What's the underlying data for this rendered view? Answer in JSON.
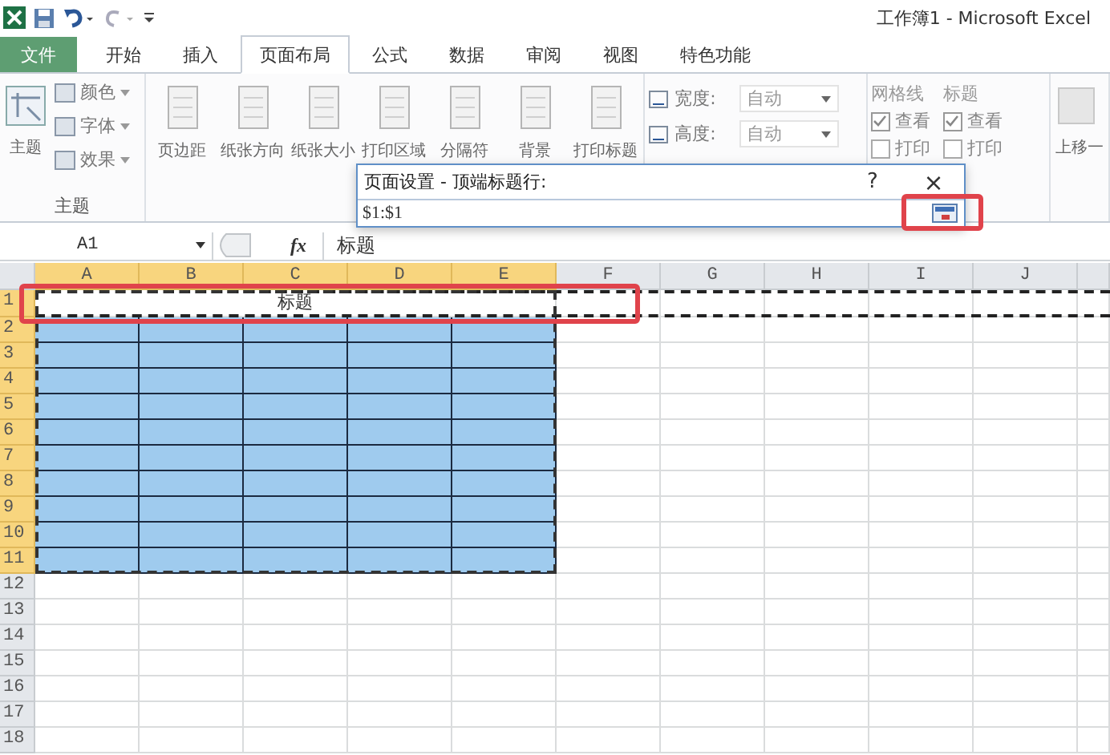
{
  "title_bar": {
    "title": "工作簿1 - Microsoft Excel"
  },
  "tabs": [
    {
      "label": "文件",
      "kind": "file",
      "selected": false
    },
    {
      "label": "开始",
      "kind": "tab",
      "selected": false
    },
    {
      "label": "插入",
      "kind": "tab",
      "selected": false
    },
    {
      "label": "页面布局",
      "kind": "tab",
      "selected": true
    },
    {
      "label": "公式",
      "kind": "tab",
      "selected": false
    },
    {
      "label": "数据",
      "kind": "tab",
      "selected": false
    },
    {
      "label": "审阅",
      "kind": "tab",
      "selected": false
    },
    {
      "label": "视图",
      "kind": "tab",
      "selected": false
    },
    {
      "label": "特色功能",
      "kind": "tab",
      "selected": false
    }
  ],
  "ribbon": {
    "theme_group": {
      "label": "主题",
      "big_button": "主题",
      "items": [
        "颜色",
        "字体",
        "效果"
      ]
    },
    "page_setup_buttons": [
      "页边距",
      "纸张方向",
      "纸张大小",
      "打印区域",
      "分隔符",
      "背景",
      "打印标题"
    ],
    "scale": [
      {
        "label": "宽度:",
        "value": "自动"
      },
      {
        "label": "高度:",
        "value": "自动"
      }
    ],
    "sheet_options": [
      {
        "title": "网格线",
        "options": [
          {
            "label": "查看",
            "checked": true
          },
          {
            "label": "打印",
            "checked": false
          }
        ]
      },
      {
        "title": "标题",
        "options": [
          {
            "label": "查看",
            "checked": true
          },
          {
            "label": "打印",
            "checked": false
          }
        ]
      }
    ],
    "arrange_button": "上移一"
  },
  "dialog": {
    "title": "页面设置 - 顶端标题行:",
    "help": "?",
    "close": "×",
    "value": "$1:$1"
  },
  "formula_bar": {
    "name_box": "A1",
    "fx": "fx",
    "content": "标题"
  },
  "sheet": {
    "title_cell": "标题",
    "columns": [
      {
        "label": "A",
        "selected": true
      },
      {
        "label": "B",
        "selected": true
      },
      {
        "label": "C",
        "selected": true
      },
      {
        "label": "D",
        "selected": true
      },
      {
        "label": "E",
        "selected": true
      },
      {
        "label": "F",
        "selected": false
      },
      {
        "label": "G",
        "selected": false
      },
      {
        "label": "H",
        "selected": false
      },
      {
        "label": "I",
        "selected": false
      },
      {
        "label": "J",
        "selected": false
      }
    ],
    "rows": [
      {
        "label": "1",
        "kind": "title",
        "selected": true
      },
      {
        "label": "2",
        "kind": "filled",
        "selected": true
      },
      {
        "label": "3",
        "kind": "filled",
        "selected": true
      },
      {
        "label": "4",
        "kind": "filled",
        "selected": true
      },
      {
        "label": "5",
        "kind": "filled",
        "selected": true
      },
      {
        "label": "6",
        "kind": "filled",
        "selected": true
      },
      {
        "label": "7",
        "kind": "filled",
        "selected": true
      },
      {
        "label": "8",
        "kind": "filled",
        "selected": true
      },
      {
        "label": "9",
        "kind": "filled",
        "selected": true
      },
      {
        "label": "10",
        "kind": "filled",
        "selected": true
      },
      {
        "label": "11",
        "kind": "filled",
        "selected": true
      },
      {
        "label": "12",
        "kind": "empty",
        "selected": false
      },
      {
        "label": "13",
        "kind": "empty",
        "selected": false
      },
      {
        "label": "14",
        "kind": "empty",
        "selected": false
      },
      {
        "label": "15",
        "kind": "empty",
        "selected": false
      },
      {
        "label": "16",
        "kind": "empty",
        "selected": false
      },
      {
        "label": "17",
        "kind": "empty",
        "selected": false
      },
      {
        "label": "18",
        "kind": "empty",
        "selected": false
      }
    ]
  }
}
